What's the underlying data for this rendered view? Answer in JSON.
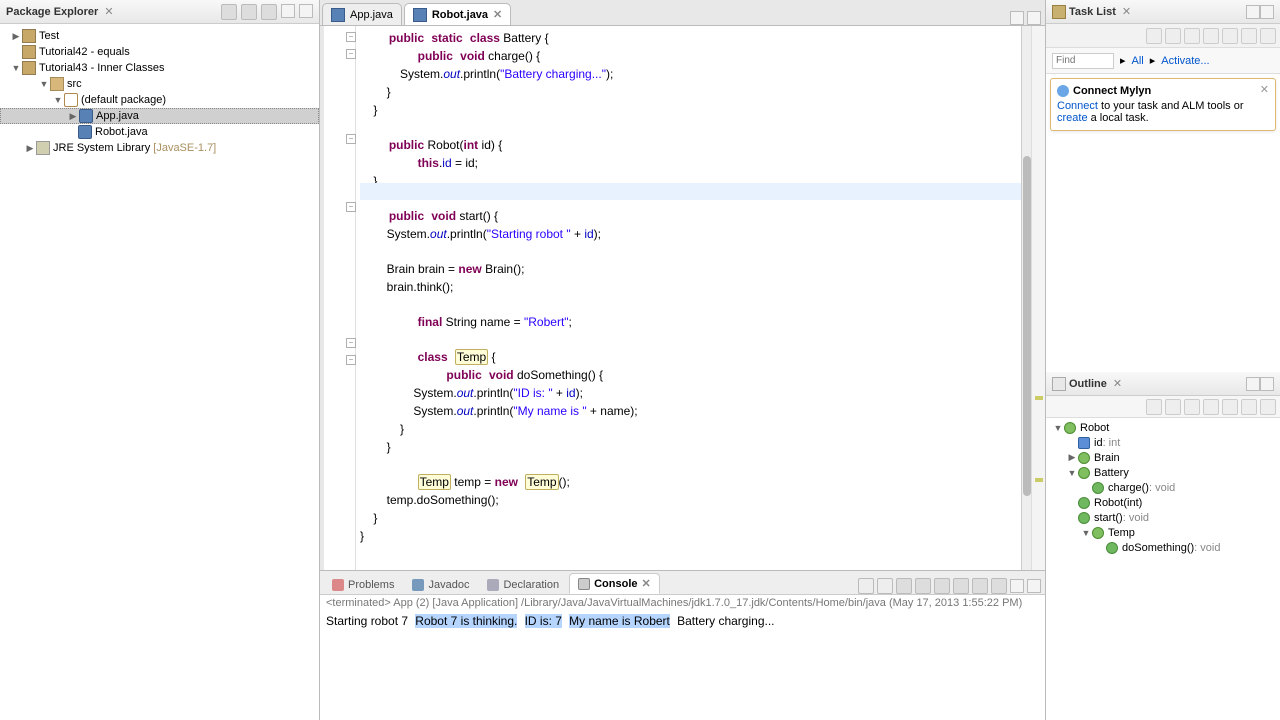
{
  "packageExplorer": {
    "title": "Package Explorer",
    "nodes": {
      "test": "Test",
      "tut42": "Tutorial42 - equals",
      "tut43": "Tutorial43 - Inner Classes",
      "src": "src",
      "defpkg": "(default package)",
      "app": "App.java",
      "robot": "Robot.java",
      "jre": "JRE System Library",
      "jreVer": "[JavaSE-1.7]"
    }
  },
  "editor": {
    "tabs": [
      {
        "label": "App.java",
        "active": false
      },
      {
        "label": "Robot.java",
        "active": true
      }
    ],
    "code": {
      "l1a": "public",
      "l1b": "static",
      "l1c": "class",
      "l1d": " Battery {",
      "l2a": "public",
      "l2b": "void",
      "l2c": " charge() {",
      "l3a": "            System.",
      "l3b": "out",
      "l3c": ".println(",
      "l3d": "\"Battery charging...\"",
      "l3e": ");",
      "l4": "        }",
      "l5": "    }",
      "l7a": "public",
      "l7b": " Robot(",
      "l7c": "int",
      "l7d": " id) {",
      "l8a": "this",
      "l8b": ".",
      "l8c": "id",
      "l8d": " = id;",
      "l9": "    }",
      "l11a": "public",
      "l11b": "void",
      "l11c": " start() {",
      "l12a": "        System.",
      "l12b": "out",
      "l12c": ".println(",
      "l12d": "\"Starting robot \"",
      "l12e": " + ",
      "l12f": "id",
      "l12g": ");",
      "l14a": "        Brain brain = ",
      "l14b": "new",
      "l14c": " Brain();",
      "l15": "        brain.think();",
      "l17a": "final",
      "l17b": " String name = ",
      "l17c": "\"Robert\"",
      "l17d": ";",
      "l19a": "class",
      "l19b": "Temp",
      "l19c": " {",
      "l20a": "public",
      "l20b": "void",
      "l20c": " doSomething() {",
      "l21a": "                System.",
      "l21b": "out",
      "l21c": ".println(",
      "l21d": "\"ID is: \"",
      "l21e": " + ",
      "l21f": "id",
      "l21g": ");",
      "l22a": "                System.",
      "l22b": "out",
      "l22c": ".println(",
      "l22d": "\"My name is \"",
      "l22e": " + name);",
      "l23": "            }",
      "l24": "        }",
      "l26a": "Temp",
      "l26b": " temp = ",
      "l26c": "new",
      "l26d": "Temp",
      "l26e": "();",
      "l27": "        temp.doSomething();",
      "l28": "    }",
      "l29": "}"
    }
  },
  "bottom": {
    "tabs": {
      "problems": "Problems",
      "javadoc": "Javadoc",
      "declaration": "Declaration",
      "console": "Console"
    },
    "consoleTitle": "<terminated> App (2) [Java Application] /Library/Java/JavaVirtualMachines/jdk1.7.0_17.jdk/Contents/Home/bin/java (May 17, 2013 1:55:22 PM)",
    "out": {
      "l1": "Starting robot 7",
      "l2": "Robot 7 is thinking.",
      "l3": "ID is: 7",
      "l4": "My name is Robert",
      "l5": "Battery charging..."
    }
  },
  "taskList": {
    "title": "Task List",
    "find": "Find",
    "all": "All",
    "activate": "Activate...",
    "mylynTitle": "Connect Mylyn",
    "mylynConnect": "Connect",
    "mylynText1": " to your task and ALM tools or ",
    "mylynCreate": "create",
    "mylynText2": " a local task."
  },
  "outline": {
    "title": "Outline",
    "items": {
      "robot": "Robot",
      "id": "id",
      "idType": " : int",
      "brain": "Brain",
      "battery": "Battery",
      "charge": "charge()",
      "chargeType": " : void",
      "ctor": "Robot(int)",
      "start": "start()",
      "startType": " : void",
      "temp": "Temp",
      "doSome": "doSomething()",
      "doSomeType": " : void"
    }
  }
}
